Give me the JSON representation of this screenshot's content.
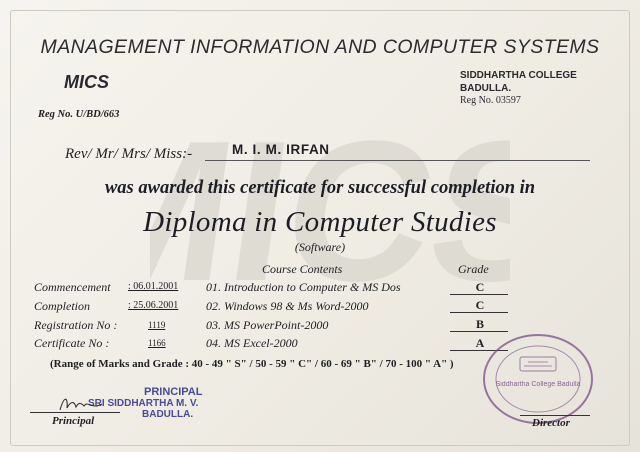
{
  "header": {
    "title": "MANAGEMENT INFORMATION AND COMPUTER SYSTEMS",
    "org_code": "MICS",
    "reg_no": "Reg No. U/BD/663",
    "college_name_line1": "SIDDHARTHA COLLEGE",
    "college_name_line2": "BADULLA.",
    "college_reg": "Reg No. 03597"
  },
  "watermark": "MICS",
  "recipient": {
    "salutation": "Rev/ Mr/ Mrs/ Miss:-",
    "name": "M. I. M. IRFAN"
  },
  "body": {
    "awarded_text": "was awarded this certificate for successful completion in",
    "diploma": "Diploma in Computer Studies",
    "stream": "(Software)"
  },
  "details": [
    {
      "label": "Commencement",
      "value": ": 06.01.2001"
    },
    {
      "label": "Completion",
      "value": ": 25.06.2001"
    },
    {
      "label": "Registration No :",
      "value": "1119"
    },
    {
      "label": "Certificate No :",
      "value": "1166"
    }
  ],
  "courses": {
    "header": "Course Contents",
    "grade_header": "Grade",
    "items": [
      {
        "course": "01. Introduction to Computer & MS Dos",
        "grade": "C"
      },
      {
        "course": "02. Windows 98 & Ms Word-2000",
        "grade": "C"
      },
      {
        "course": "03. MS PowerPoint-2000",
        "grade": "B"
      },
      {
        "course": "04. MS Excel-2000",
        "grade": "A"
      }
    ]
  },
  "grading_scale": "(Range of Marks and Grade : 40 - 49 \" S\" / 50 - 59 \" C\" / 60 - 69 \" B\" / 70 - 100 \" A\" )",
  "signatures": {
    "principal_stamp_line1": "PRINCIPAL",
    "principal_stamp_line2": "SRI SIDDHARTHA M. V.",
    "principal_stamp_line3": "BADULLA.",
    "principal_label": "Principal",
    "director_label": "Director",
    "seal_text": "Siddhartha College Badulla"
  },
  "colors": {
    "ink": "#1f1f24",
    "stamp_blue": "#4a4a9a",
    "seal_purple": "#7a4f86",
    "watermark": "#d8d5cd"
  }
}
